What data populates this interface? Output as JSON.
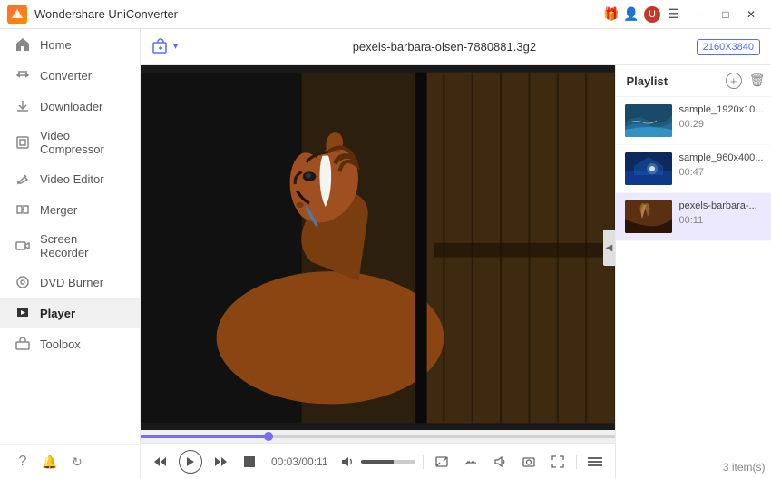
{
  "app": {
    "title": "Wondershare UniConverter",
    "logo_text": "W"
  },
  "titlebar": {
    "icons": [
      "gift-icon",
      "user-icon",
      "profile-icon",
      "menu-icon"
    ],
    "controls": [
      "minimize-btn",
      "maximize-btn",
      "close-btn"
    ]
  },
  "sidebar": {
    "items": [
      {
        "id": "home",
        "label": "Home",
        "icon": "home-icon"
      },
      {
        "id": "converter",
        "label": "Converter",
        "icon": "converter-icon"
      },
      {
        "id": "downloader",
        "label": "Downloader",
        "icon": "downloader-icon"
      },
      {
        "id": "video-compressor",
        "label": "Video Compressor",
        "icon": "compress-icon"
      },
      {
        "id": "video-editor",
        "label": "Video Editor",
        "icon": "editor-icon"
      },
      {
        "id": "merger",
        "label": "Merger",
        "icon": "merger-icon"
      },
      {
        "id": "screen-recorder",
        "label": "Screen Recorder",
        "icon": "record-icon"
      },
      {
        "id": "dvd-burner",
        "label": "DVD Burner",
        "icon": "dvd-icon"
      },
      {
        "id": "player",
        "label": "Player",
        "icon": "player-icon",
        "active": true
      },
      {
        "id": "toolbox",
        "label": "Toolbox",
        "icon": "toolbox-icon"
      }
    ],
    "bottom_icons": [
      "help-icon",
      "notification-icon",
      "sync-icon"
    ]
  },
  "player": {
    "header": {
      "add_button_label": "+",
      "file_name": "pexels-barbara-olsen-7880881.3g2",
      "resolution": "2160X3840"
    },
    "progress": {
      "current_time": "00:03",
      "total_time": "00:11",
      "time_display": "00:03/00:11",
      "fill_percent": 27
    },
    "controls": {
      "skip_back": "⏮",
      "play": "▶",
      "skip_fwd": "⏭",
      "stop": "■",
      "volume_icon": "🔊"
    }
  },
  "playlist": {
    "title": "Playlist",
    "count_label": "3 item(s)",
    "items": [
      {
        "id": 1,
        "name": "sample_1920x10...",
        "duration": "00:29",
        "active": false
      },
      {
        "id": 2,
        "name": "sample_960x400...",
        "duration": "00:47",
        "active": false
      },
      {
        "id": 3,
        "name": "pexels-barbara-...",
        "duration": "00:11",
        "active": true
      }
    ]
  }
}
